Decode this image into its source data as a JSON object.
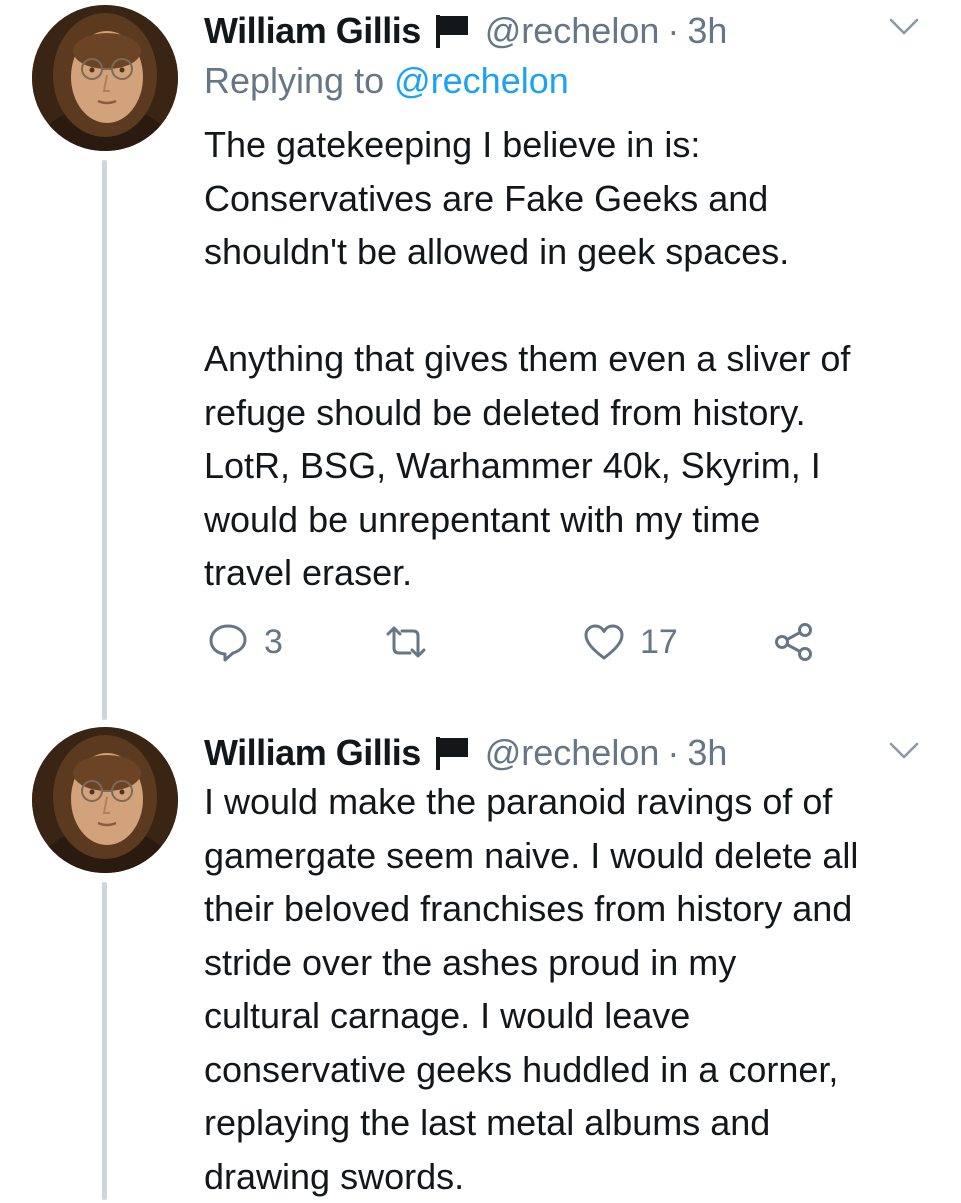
{
  "tweets": [
    {
      "name": "William Gillis",
      "handle": "@rechelon",
      "separator": "·",
      "time": "3h",
      "reply_prefix": "Replying to",
      "reply_to": "@rechelon",
      "body_lines": [
        "The gatekeeping I believe in is:",
        "Conservatives are Fake Geeks and",
        "shouldn't be allowed in geek spaces.",
        "",
        "Anything that gives them even a sliver of",
        "refuge should be deleted from history.",
        "LotR, BSG, Warhammer 40k, Skyrim, I",
        "would be unrepentant with my time",
        "travel eraser."
      ],
      "actions": {
        "reply_count": "3",
        "retweet_count": "",
        "like_count": "17"
      }
    },
    {
      "name": "William Gillis",
      "handle": "@rechelon",
      "separator": "·",
      "time": "3h",
      "body_lines": [
        "I would make the paranoid ravings of of",
        "gamergate seem naive. I would delete all",
        "their beloved franchises from history and",
        "stride over the ashes proud in my",
        "cultural carnage. I would leave",
        "conservative geeks huddled in a corner,",
        "replaying the last metal albums and",
        "drawing swords."
      ]
    }
  ],
  "icons": {
    "flag": "black-flag-icon",
    "caret": "chevron-down-icon",
    "reply": "reply-icon",
    "retweet": "retweet-icon",
    "like": "heart-icon",
    "share": "share-icon"
  },
  "colors": {
    "text": "#14171a",
    "secondary": "#657786",
    "link": "#1da1f2",
    "thread_line": "#ccd6dd",
    "background": "#ffffff"
  }
}
